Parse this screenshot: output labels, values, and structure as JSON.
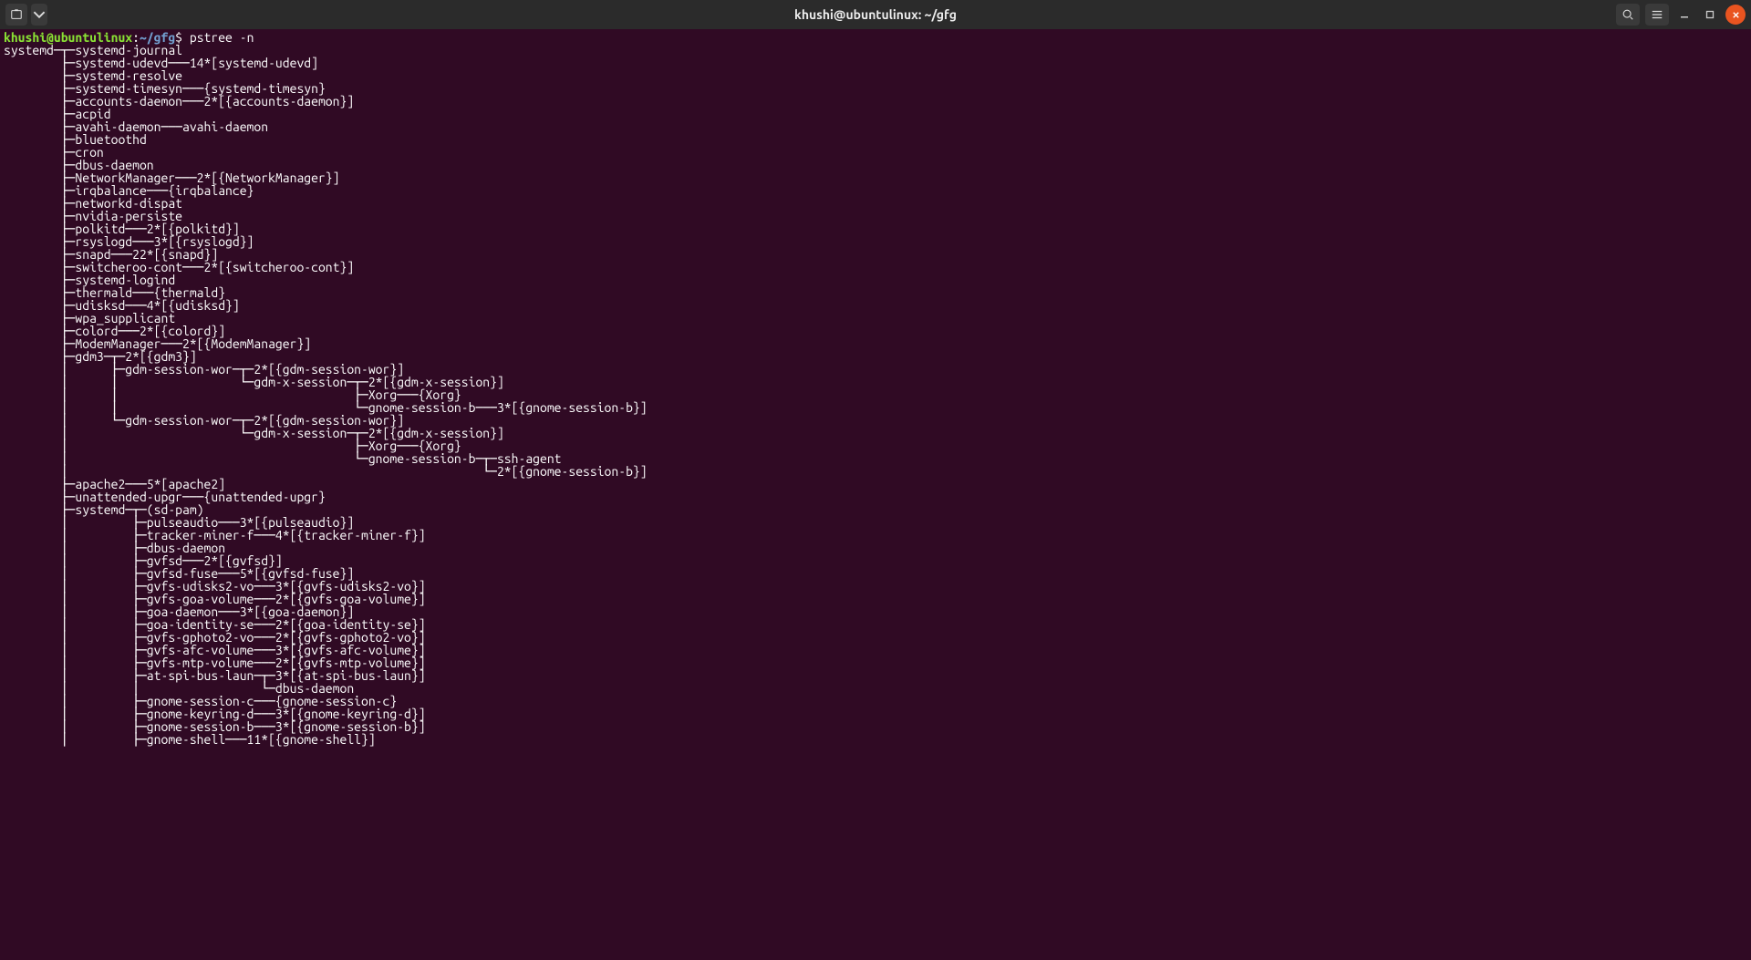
{
  "window": {
    "title": "khushi@ubuntulinux: ~/gfg"
  },
  "prompt": {
    "user_host": "khushi@ubuntulinux",
    "sep": ":",
    "path": "~/gfg",
    "dollar": "$",
    "command": "pstree -n"
  },
  "tree": "systemd─┬─systemd-journal\n        ├─systemd-udevd───14*[systemd-udevd]\n        ├─systemd-resolve\n        ├─systemd-timesyn───{systemd-timesyn}\n        ├─accounts-daemon───2*[{accounts-daemon}]\n        ├─acpid\n        ├─avahi-daemon───avahi-daemon\n        ├─bluetoothd\n        ├─cron\n        ├─dbus-daemon\n        ├─NetworkManager───2*[{NetworkManager}]\n        ├─irqbalance───{irqbalance}\n        ├─networkd-dispat\n        ├─nvidia-persiste\n        ├─polkitd───2*[{polkitd}]\n        ├─rsyslogd───3*[{rsyslogd}]\n        ├─snapd───22*[{snapd}]\n        ├─switcheroo-cont───2*[{switcheroo-cont}]\n        ├─systemd-logind\n        ├─thermald───{thermald}\n        ├─udisksd───4*[{udisksd}]\n        ├─wpa_supplicant\n        ├─colord───2*[{colord}]\n        ├─ModemManager───2*[{ModemManager}]\n        ├─gdm3─┬─2*[{gdm3}]\n        │      ├─gdm-session-wor─┬─2*[{gdm-session-wor}]\n        │      │                 └─gdm-x-session─┬─2*[{gdm-x-session}]\n        │      │                                 ├─Xorg───{Xorg}\n        │      │                                 └─gnome-session-b───3*[{gnome-session-b}]\n        │      └─gdm-session-wor─┬─2*[{gdm-session-wor}]\n        │                        └─gdm-x-session─┬─2*[{gdm-x-session}]\n        │                                        ├─Xorg───{Xorg}\n        │                                        └─gnome-session-b─┬─ssh-agent\n        │                                                          └─2*[{gnome-session-b}]\n        ├─apache2───5*[apache2]\n        ├─unattended-upgr───{unattended-upgr}\n        ├─systemd─┬─(sd-pam)\n        │         ├─pulseaudio───3*[{pulseaudio}]\n        │         ├─tracker-miner-f───4*[{tracker-miner-f}]\n        │         ├─dbus-daemon\n        │         ├─gvfsd───2*[{gvfsd}]\n        │         ├─gvfsd-fuse───5*[{gvfsd-fuse}]\n        │         ├─gvfs-udisks2-vo───3*[{gvfs-udisks2-vo}]\n        │         ├─gvfs-goa-volume───2*[{gvfs-goa-volume}]\n        │         ├─goa-daemon───3*[{goa-daemon}]\n        │         ├─goa-identity-se───2*[{goa-identity-se}]\n        │         ├─gvfs-gphoto2-vo───2*[{gvfs-gphoto2-vo}]\n        │         ├─gvfs-afc-volume───3*[{gvfs-afc-volume}]\n        │         ├─gvfs-mtp-volume───2*[{gvfs-mtp-volume}]\n        │         ├─at-spi-bus-laun─┬─3*[{at-spi-bus-laun}]\n        │         │                 └─dbus-daemon\n        │         ├─gnome-session-c───{gnome-session-c}\n        │         ├─gnome-keyring-d───3*[{gnome-keyring-d}]\n        │         ├─gnome-session-b───3*[{gnome-session-b}]\n        │         ├─gnome-shell───11*[{gnome-shell}]"
}
